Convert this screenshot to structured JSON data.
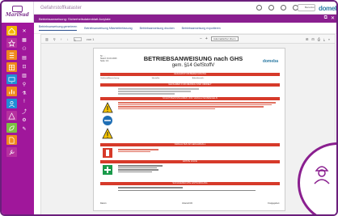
{
  "app": {
    "title": "Gefahrstoffkataster",
    "logo_text": "MariSud",
    "brand": "domeba",
    "user_label": "Benutzer"
  },
  "subbar": {
    "title": "Betriebsanweisung: Sicherheitsdatenblatt Acrylate",
    "icons": [
      "restore-icon",
      "close-icon"
    ]
  },
  "tabs": [
    {
      "label": "Betriebsanweisung generieren",
      "active": true
    },
    {
      "label": "Betriebsanweisung Mitarbeiterfassung",
      "active": false
    },
    {
      "label": "Betriebsanweisung drucken",
      "active": false
    },
    {
      "label": "Betriebsanweisung exportieren",
      "active": false
    }
  ],
  "viewer": {
    "page_current": "1",
    "page_total": "von 1",
    "zoom_label": "Automatischer Zoom"
  },
  "document": {
    "meta": [
      "Nr.: ...",
      "Stand: 01.01.2023",
      "Seite: 1/1"
    ],
    "title": "BETRIEBSANWEISUNG nach GHS",
    "subtitle": "gem. §14 GefStoffV",
    "logo": "domeba",
    "sections": [
      "GEFAHRSTOFFBEZEICHNUNG",
      "GEFAHREN FÜR MENSCH UND UMWELT",
      "SCHUTZMASSNAHMEN UND VERHALTENSREGELN",
      "VERHALTEN IM GEFAHRFALL",
      "ERSTE HILFE",
      "SACHGERECHTE ENTSORGUNG"
    ],
    "row_labels": [
      "Gefahrstoffbezeichnung:",
      "Hersteller:",
      "Arbeitsbereich:"
    ],
    "sign_labels": [
      "Datum:",
      "Unterschrift:",
      "Freigegeben:"
    ]
  },
  "colors": {
    "rail": "#a0179b",
    "accent": "#8a1f8f",
    "section_red": "#d63a2a",
    "brand_blue": "#2b7aa3"
  }
}
